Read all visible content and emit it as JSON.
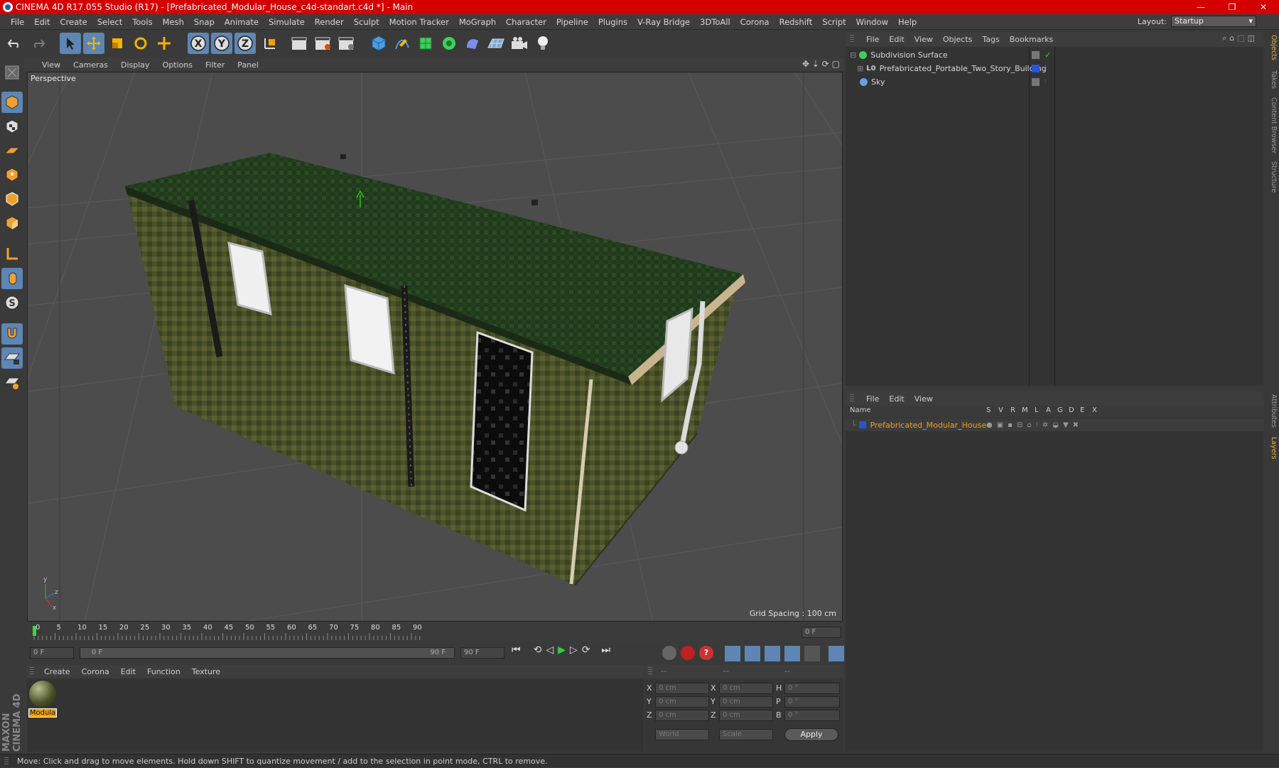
{
  "window": {
    "title": "CINEMA 4D R17.055 Studio (R17) - [Prefabricated_Modular_House_c4d-standart.c4d *] - Main",
    "minimize": "—",
    "restore": "❐",
    "close": "✕"
  },
  "menubar": [
    "File",
    "Edit",
    "Create",
    "Select",
    "Tools",
    "Mesh",
    "Snap",
    "Animate",
    "Simulate",
    "Render",
    "Sculpt",
    "Motion Tracker",
    "MoGraph",
    "Character",
    "Pipeline",
    "Plugins",
    "V-Ray Bridge",
    "3DToAll",
    "Corona",
    "Redshift",
    "Script",
    "Window",
    "Help"
  ],
  "layout": {
    "label": "Layout:",
    "value": "Startup"
  },
  "toolbar": {
    "axis_x": "X",
    "axis_y": "Y",
    "axis_z": "Z"
  },
  "viewport": {
    "menu": [
      "View",
      "Cameras",
      "Display",
      "Options",
      "Filter",
      "Panel"
    ],
    "label": "Perspective",
    "grid_spacing": "Grid Spacing : 100 cm"
  },
  "timeline": {
    "ticks": [
      "0",
      "5",
      "10",
      "15",
      "20",
      "25",
      "30",
      "35",
      "40",
      "45",
      "50",
      "55",
      "60",
      "65",
      "70",
      "75",
      "80",
      "85",
      "90"
    ],
    "current_frame": "0 F"
  },
  "transport": {
    "start_field": "0 F",
    "range_start": "0 F",
    "range_end": "90 F",
    "end_field": "90 F"
  },
  "material_manager": {
    "menu": [
      "Create",
      "Corona",
      "Edit",
      "Function",
      "Texture"
    ],
    "materials": [
      {
        "label": "Modula"
      }
    ]
  },
  "coordinates": {
    "header": [
      "--",
      "--",
      "--"
    ],
    "rows": [
      {
        "a": "X",
        "av": "0 cm",
        "b": "X",
        "bv": "0 cm",
        "c": "H",
        "cv": "0 °"
      },
      {
        "a": "Y",
        "av": "0 cm",
        "b": "Y",
        "bv": "0 cm",
        "c": "P",
        "cv": "0 °"
      },
      {
        "a": "Z",
        "av": "0 cm",
        "b": "Z",
        "bv": "0 cm",
        "c": "B",
        "cv": "0 °"
      }
    ],
    "mode1": "World",
    "mode2": "Scale",
    "apply": "Apply"
  },
  "object_manager": {
    "menu": [
      "File",
      "Edit",
      "View",
      "Objects",
      "Tags",
      "Bookmarks"
    ],
    "objects": [
      {
        "name": "Subdivision Surface"
      },
      {
        "name": "Prefabricated_Portable_Two_Story_Building"
      },
      {
        "name": "Sky"
      }
    ]
  },
  "layer_manager": {
    "menu": [
      "File",
      "Edit",
      "View"
    ],
    "columns": [
      "Name",
      "S",
      "V",
      "R",
      "M",
      "L",
      "A",
      "G",
      "D",
      "E",
      "X"
    ],
    "layers": [
      {
        "name": "Prefabricated_Modular_House"
      }
    ]
  },
  "right_tabs": [
    "Objects",
    "Takes",
    "Content Browser",
    "Structure",
    "Attributes",
    "Layers"
  ],
  "brand": "MAXON CINEMA 4D",
  "status": "Move: Click and drag to move elements. Hold down SHIFT to quantize movement / add to the selection in point mode, CTRL to remove.",
  "colors": {
    "title_red": "#d40000",
    "accent_blue": "#5d86b4",
    "layer_orange": "#f0a020"
  }
}
